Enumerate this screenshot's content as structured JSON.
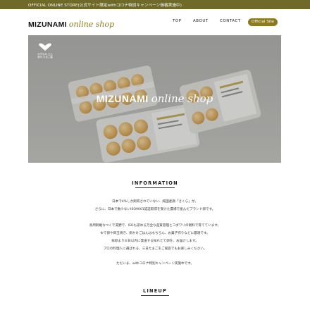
{
  "topbar": {
    "text": "OFFICIAL ONLINE STORE(公式サイト限定withコロナ特別キャンペーン価格実施中)"
  },
  "header": {
    "logo_brand": "MIZUNAMI",
    "logo_sub": "online shop",
    "nav": {
      "top": "TOP",
      "about": "ABOUT",
      "contact": "CONTACT",
      "official": "Official Site"
    }
  },
  "hero": {
    "brand": "MIZUNAMI",
    "sub": "online shop",
    "badge_icon": "heart-icon",
    "badge_text": "みずなみ さん家の たまご農"
  },
  "information": {
    "heading": "INFORMATION",
    "lines": [
      "日本で4%しか飼育されていない、純国産鶏「さくら」が。",
      "さらに、日本で数少ないISO9001認証取得を受けた農場で産んだブランド卵です。",
      "",
      "鳥所飼継なつくで湯野で、ISOも認める万全な品質管理とコダワリの飼料で育てています。",
      "ゆで卵や目玉焼き、卵かけごはんはもちろん、お菓子作りなどに最適です。",
      "採卵より三日以内に発送する採れたて卵を、お届けします。",
      "プロの料理人に選ばれる、三日たまごをご家庭でもお楽しみください。",
      "",
      "ただいま、withコロナ特別キャンペーン実施中です。"
    ]
  },
  "lineup": {
    "heading": "LINEUP"
  },
  "colors": {
    "brand": "#6f6a2a",
    "accent": "#8c7a1e"
  }
}
